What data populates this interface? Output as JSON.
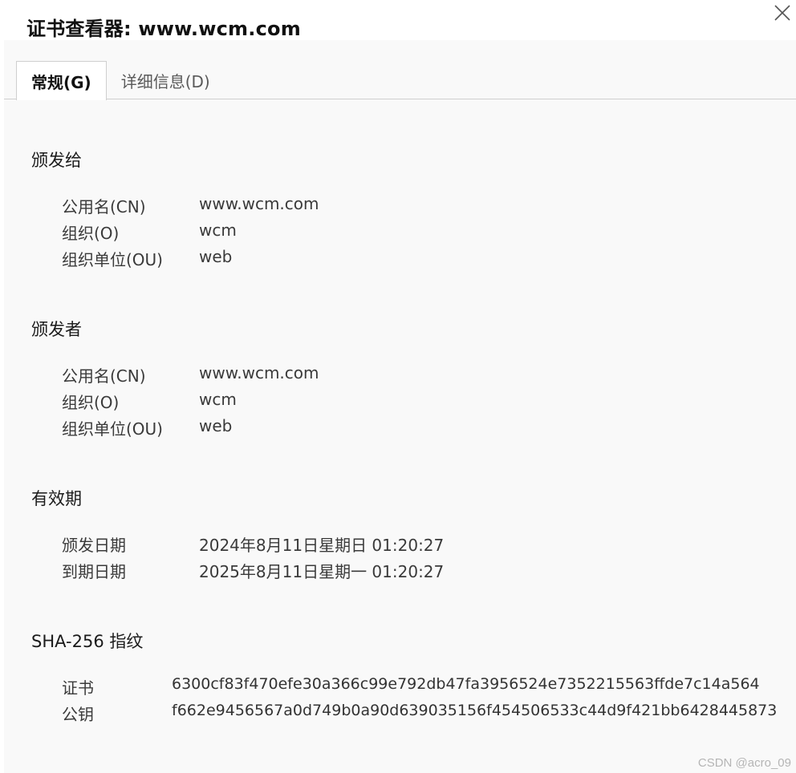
{
  "dialog": {
    "title": "证书查看器: www.wcm.com"
  },
  "tabs": [
    {
      "label": "常规(G)",
      "active": true
    },
    {
      "label": "详细信息(D)",
      "active": false
    }
  ],
  "issued_to": {
    "heading": "颁发给",
    "rows": [
      {
        "label": "公用名(CN)",
        "value": "www.wcm.com"
      },
      {
        "label": "组织(O)",
        "value": "wcm"
      },
      {
        "label": "组织单位(OU)",
        "value": "web"
      }
    ]
  },
  "issued_by": {
    "heading": "颁发者",
    "rows": [
      {
        "label": "公用名(CN)",
        "value": "www.wcm.com"
      },
      {
        "label": "组织(O)",
        "value": "wcm"
      },
      {
        "label": "组织单位(OU)",
        "value": "web"
      }
    ]
  },
  "validity": {
    "heading": "有效期",
    "rows": [
      {
        "label": "颁发日期",
        "value": "2024年8月11日星期日 01:20:27"
      },
      {
        "label": "到期日期",
        "value": "2025年8月11日星期一 01:20:27"
      }
    ]
  },
  "fingerprints": {
    "heading": "SHA-256 指纹",
    "rows": [
      {
        "label": "证书",
        "value": "6300cf83f470efe30a366c99e792db47fa3956524e7352215563ffde7c14a564"
      },
      {
        "label": "公钥",
        "value": "f662e9456567a0d749b0a90d639035156f454506533c44d9f421bb6428445873"
      }
    ]
  },
  "watermark": "CSDN @acro_09",
  "icons": {
    "close": "close-icon"
  }
}
